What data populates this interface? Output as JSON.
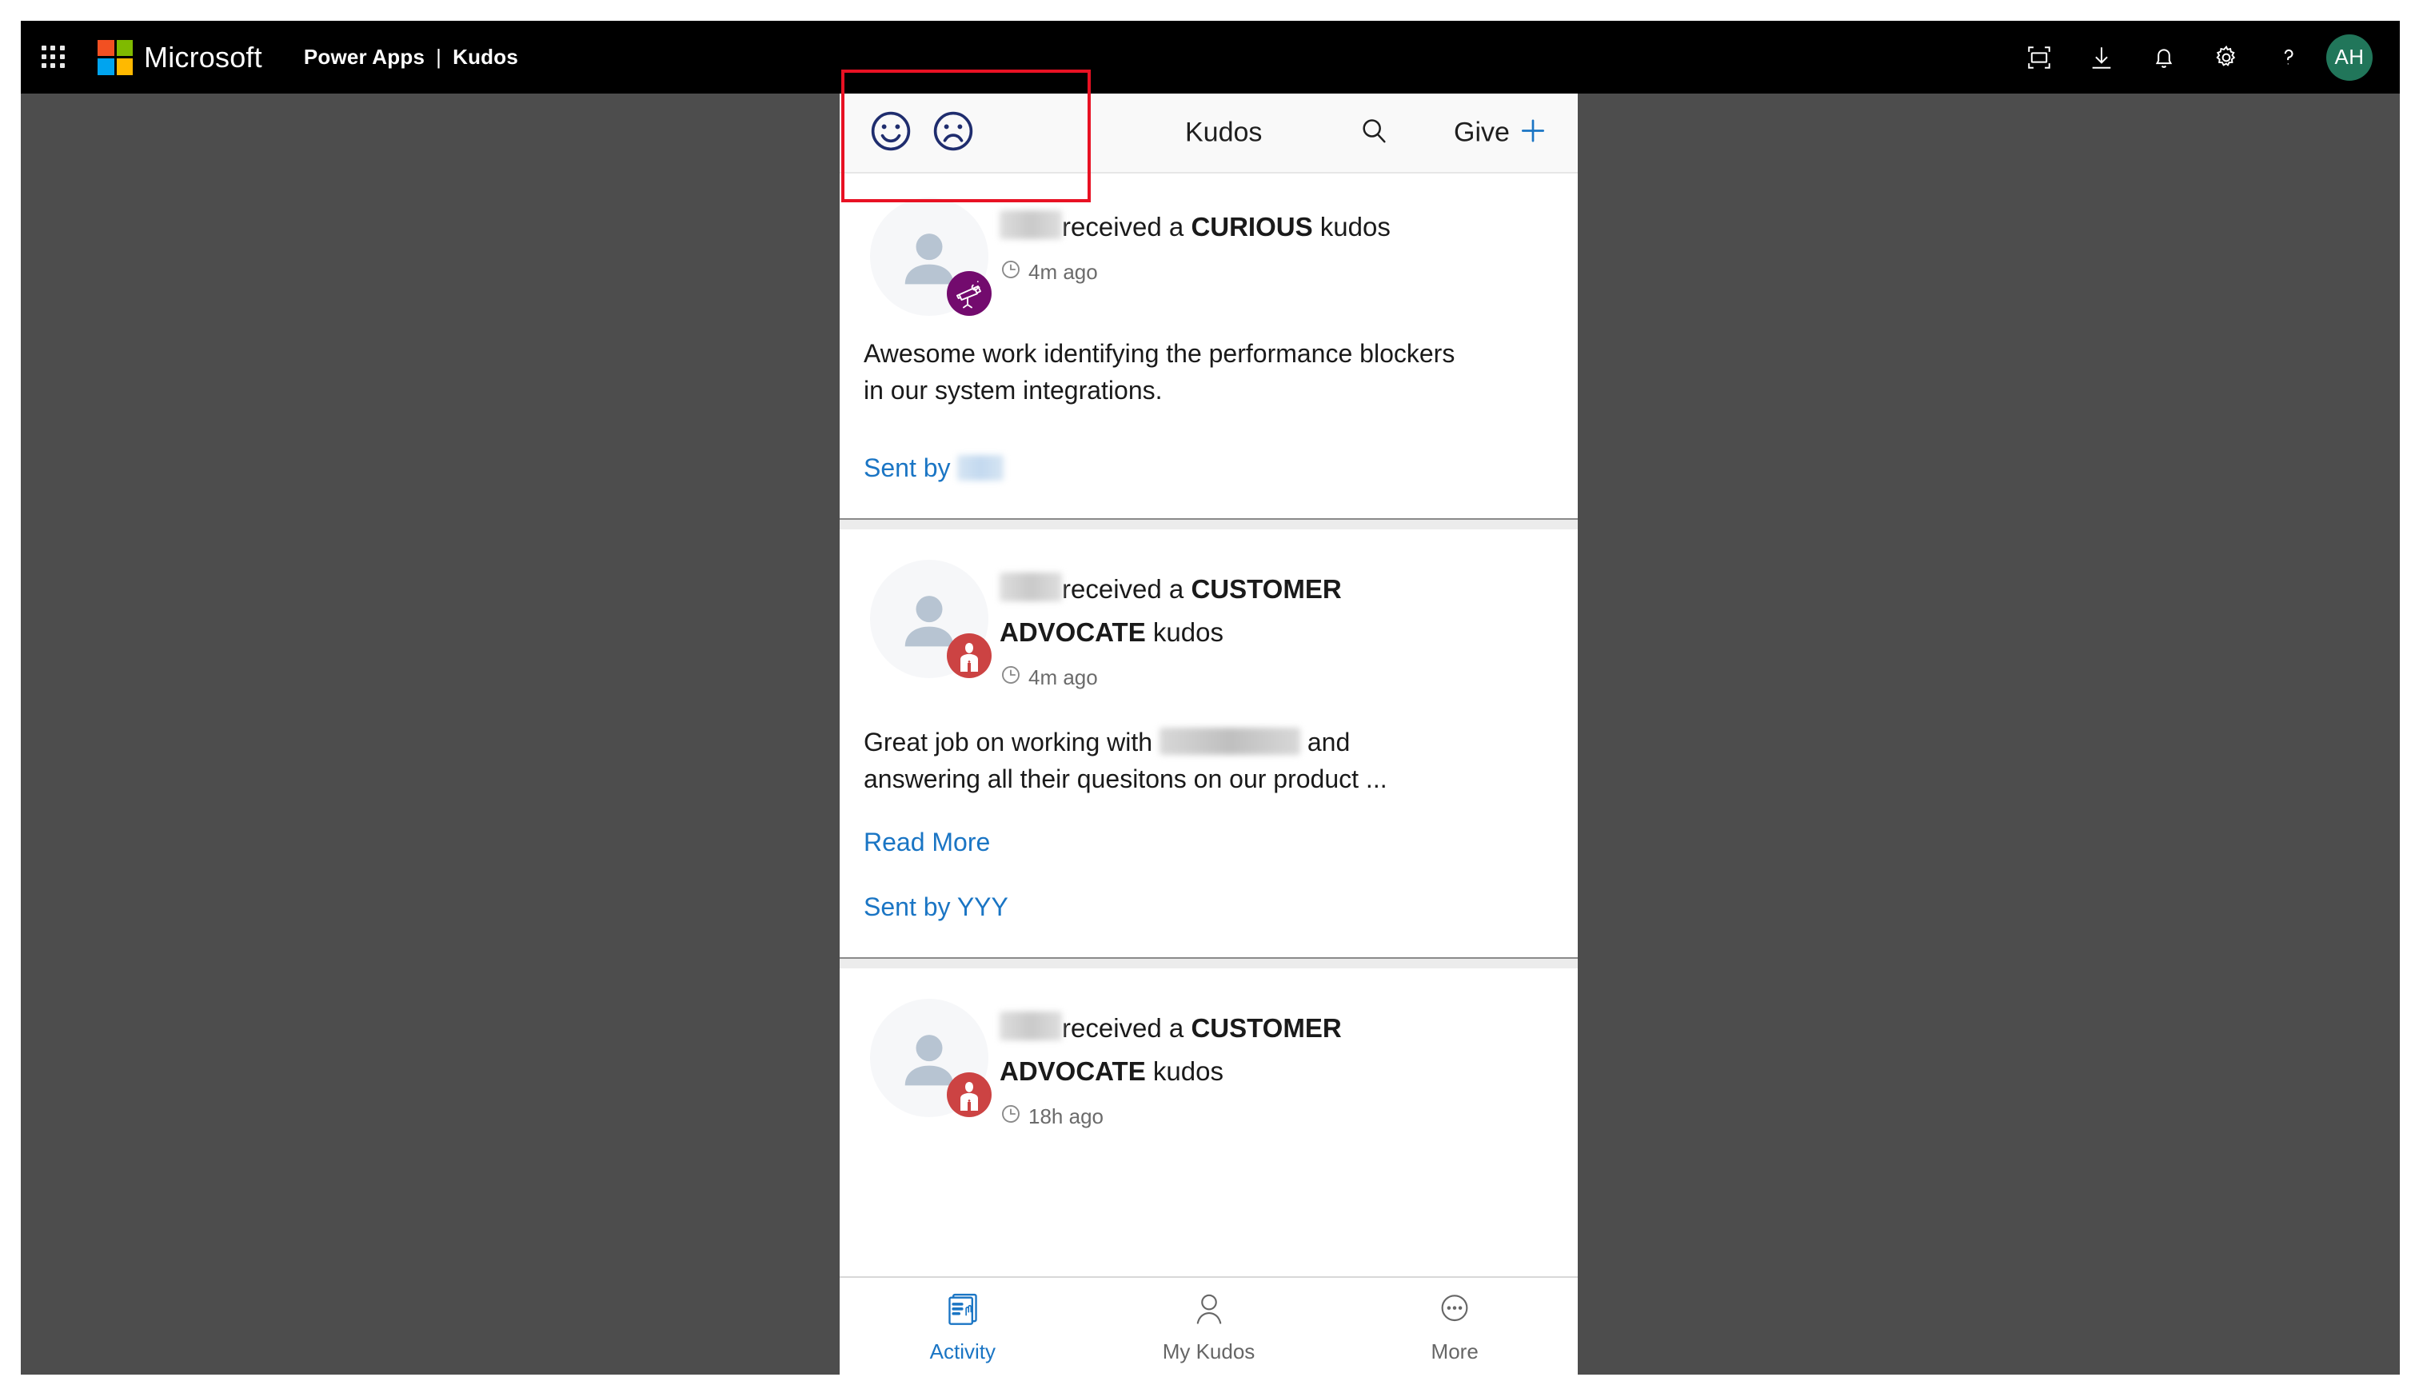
{
  "suite": {
    "waffle_label": "app-launcher",
    "brand": "Microsoft",
    "app_name": "Power Apps",
    "separator": "|",
    "page_name": "Kudos",
    "actions": [
      {
        "name": "fit-to-screen-icon",
        "label": "Fit to screen"
      },
      {
        "name": "download-icon",
        "label": "Download"
      },
      {
        "name": "notifications-bell-icon",
        "label": "Notifications"
      },
      {
        "name": "settings-gear-icon",
        "label": "Settings"
      },
      {
        "name": "help-question-icon",
        "label": "Help"
      }
    ],
    "avatar_initials": "AH"
  },
  "app_header": {
    "feedback_positive_icon": "smiley-happy-icon",
    "feedback_negative_icon": "smiley-sad-icon",
    "title": "Kudos",
    "search_icon": "search-icon",
    "give_label": "Give",
    "give_plus_icon": "plus-icon",
    "accent_blue": "#1a75c4",
    "emoji_navy": "#1f2d6e"
  },
  "feed": {
    "cards": [
      {
        "recipient": "",
        "received_text": "received a",
        "kudos_type": "CURIOUS",
        "kudos_suffix": "kudos",
        "badge_icon": "telescope-icon",
        "badge_color": "#730b6e",
        "timestamp": "4m ago",
        "message_line_1": "Awesome work identifying the performance",
        "message_line_2": "blockers in our system integrations.",
        "has_read_more": false,
        "read_more_label": "",
        "sent_by_label": "Sent by",
        "sender": ""
      },
      {
        "recipient": "",
        "received_text": "received a",
        "kudos_type": "CUSTOMER ADVOCATE",
        "kudos_suffix": "kudos",
        "badge_icon": "customer-advocate-person-icon",
        "badge_color": "#cc4343",
        "timestamp": "4m ago",
        "message_line_1": "Great job on working with",
        "message_line_1_tail": "and",
        "message_line_2": "answering all their quesitons on our product ...",
        "has_read_more": true,
        "read_more_label": "Read More",
        "sent_by_label": "Sent by YYY",
        "sender": "YYY"
      },
      {
        "recipient": "",
        "received_text": "received a",
        "kudos_type": "CUSTOMER ADVOCATE",
        "kudos_suffix": "kudos",
        "badge_icon": "customer-advocate-person-icon",
        "badge_color": "#cc4343",
        "timestamp": "18h ago",
        "message_line_1": "",
        "message_line_2": "",
        "has_read_more": false,
        "read_more_label": "",
        "sent_by_label": "",
        "sender": ""
      }
    ]
  },
  "bottom_nav": {
    "items": [
      {
        "label": "Activity",
        "icon": "activity-feed-icon",
        "active": true
      },
      {
        "label": "My Kudos",
        "icon": "person-icon",
        "active": false
      },
      {
        "label": "More",
        "icon": "ellipsis-icon",
        "active": false
      }
    ]
  },
  "annotation": {
    "highlight_color": "#e81123",
    "target": "feedback-emoji-buttons"
  }
}
